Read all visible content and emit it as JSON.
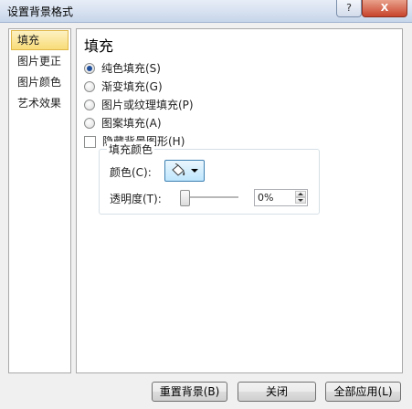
{
  "window": {
    "title": "设置背景格式",
    "help_label": "?",
    "close_label": "X"
  },
  "nav": {
    "items": [
      {
        "label": "填充",
        "active": true
      },
      {
        "label": "图片更正",
        "active": false
      },
      {
        "label": "图片颜色",
        "active": false
      },
      {
        "label": "艺术效果",
        "active": false
      }
    ]
  },
  "fill": {
    "heading": "填充",
    "options": [
      {
        "label": "纯色填充(S)",
        "checked": true
      },
      {
        "label": "渐变填充(G)",
        "checked": false
      },
      {
        "label": "图片或纹理填充(P)",
        "checked": false
      },
      {
        "label": "图案填充(A)",
        "checked": false
      }
    ],
    "hide_bg_label": "隐藏背景图形(H)",
    "hide_bg_checked": false,
    "fill_color_group": "填充颜色",
    "color_label": "颜色(C):",
    "transparency_label": "透明度(T):",
    "transparency_value": "0%"
  },
  "buttons": {
    "reset": "重置背景(B)",
    "close": "关闭",
    "apply_all": "全部应用(L)"
  },
  "icons": [
    "paint-bucket-icon",
    "dropdown-caret-icon",
    "spin-up-icon",
    "spin-down-icon"
  ]
}
